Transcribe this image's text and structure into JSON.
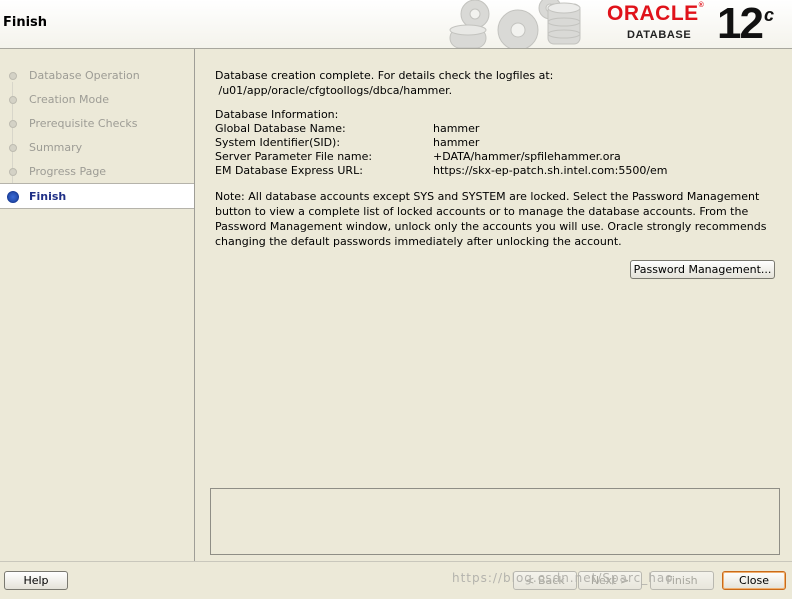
{
  "header": {
    "title": "Finish",
    "brand_oracle": "ORACLE",
    "brand_db": "DATABASE",
    "brand_version": "12",
    "brand_version_sup": "c"
  },
  "sidebar": {
    "steps": [
      {
        "label": "Database Operation",
        "state": "done"
      },
      {
        "label": "Creation Mode",
        "state": "done"
      },
      {
        "label": "Prerequisite Checks",
        "state": "done"
      },
      {
        "label": "Summary",
        "state": "done"
      },
      {
        "label": "Progress Page",
        "state": "done"
      },
      {
        "label": "Finish",
        "state": "active"
      }
    ]
  },
  "main": {
    "intro_line1": "Database creation complete. For details check the logfiles at:",
    "intro_line2": " /u01/app/oracle/cfgtoollogs/dbca/hammer.",
    "info_heading": "Database Information:",
    "info": [
      {
        "label": "Global Database Name:",
        "value": "hammer"
      },
      {
        "label": "System Identifier(SID):",
        "value": "hammer"
      },
      {
        "label": "Server Parameter File name:",
        "value": "+DATA/hammer/spfilehammer.ora"
      },
      {
        "label": "EM Database Express URL:",
        "value": "https://skx-ep-patch.sh.intel.com:5500/em"
      }
    ],
    "note": "Note: All database accounts except SYS and SYSTEM are locked. Select the Password Management button to view a complete list of locked accounts or to manage the database accounts. From the Password Management window, unlock only the accounts you will use. Oracle strongly recommends changing the default passwords immediately after unlocking the account.",
    "password_button": "Password Management..."
  },
  "footer": {
    "help": "Help",
    "back": "< Back",
    "next": "Next >",
    "finish": "Finish",
    "close": "Close",
    "watermark": "https://blog.csdn.net/Sparc_hao"
  }
}
